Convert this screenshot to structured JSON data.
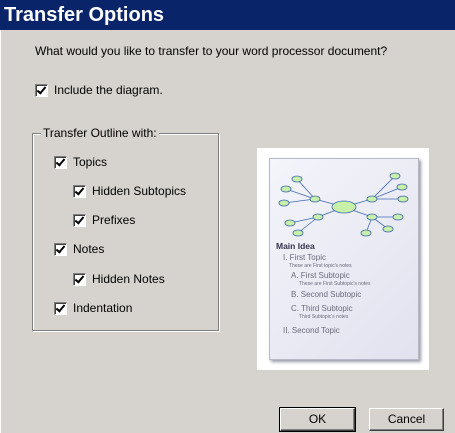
{
  "window": {
    "title": "Transfer Options"
  },
  "prompt": "What would you like to transfer to your word processor document?",
  "include_diagram": {
    "label": "Include the diagram.",
    "checked": true
  },
  "outline_group": {
    "legend": "Transfer Outline with:",
    "options": {
      "topics": {
        "label": "Topics",
        "checked": true
      },
      "hidden_subtopics": {
        "label": "Hidden Subtopics",
        "checked": true
      },
      "prefixes": {
        "label": "Prefixes",
        "checked": true
      },
      "notes": {
        "label": "Notes",
        "checked": true
      },
      "hidden_notes": {
        "label": "Hidden Notes",
        "checked": true
      },
      "indentation": {
        "label": "Indentation",
        "checked": true
      }
    }
  },
  "preview": {
    "main_idea": "Main Idea",
    "outline": [
      "I. First Topic",
      "These are First topic's notes",
      "A. First Subtopic",
      "These are First Subtopic's notes",
      "B. Second Subtopic",
      "C. Third Subtopic",
      "Third Subtopic's notes",
      "II. Second Topic"
    ],
    "node_color": "#c8f0a8",
    "line_color": "#3d6ab0"
  },
  "buttons": {
    "ok": "OK",
    "cancel": "Cancel"
  }
}
